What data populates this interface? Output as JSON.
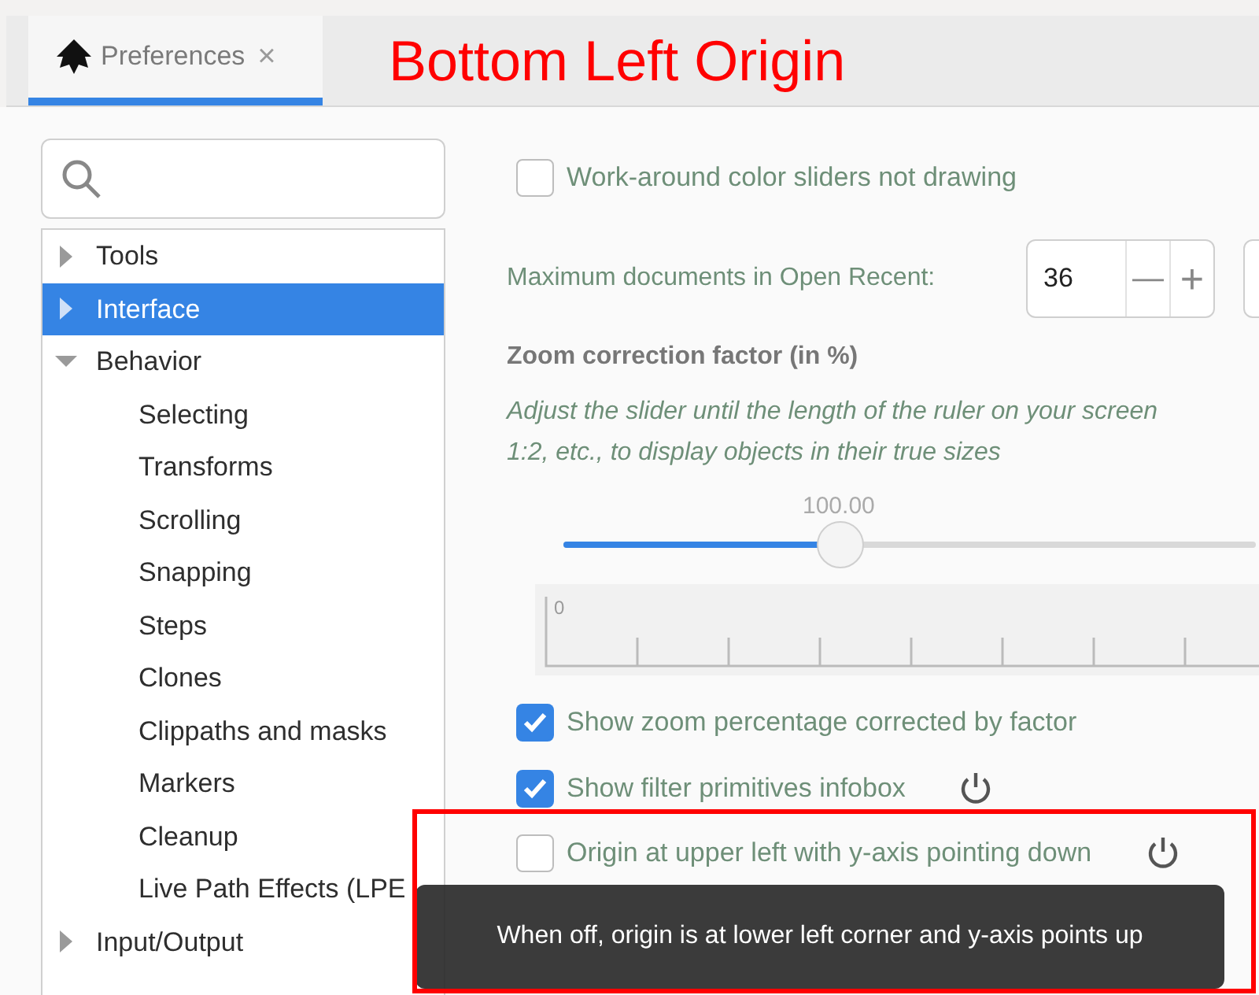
{
  "tab": {
    "label": "Preferences",
    "close": "×",
    "selected": true
  },
  "annotation": {
    "title": "Bottom Left Origin"
  },
  "tree": [
    {
      "label": "Tools",
      "expanded": false,
      "selected": false
    },
    {
      "label": "Interface",
      "expanded": false,
      "selected": true
    },
    {
      "label": "Behavior",
      "expanded": true,
      "selected": false,
      "children": [
        {
          "label": "Selecting",
          "selected": false
        },
        {
          "label": "Transforms",
          "selected": false
        },
        {
          "label": "Scrolling",
          "selected": false
        },
        {
          "label": "Snapping",
          "selected": false
        },
        {
          "label": "Steps",
          "selected": false
        },
        {
          "label": "Clones",
          "selected": false
        },
        {
          "label": "Clippaths and masks",
          "selected": false
        },
        {
          "label": "Markers",
          "selected": false
        },
        {
          "label": "Cleanup",
          "selected": false
        },
        {
          "label": "Live Path Effects (LPE",
          "selected": false
        }
      ]
    },
    {
      "label": "Input/Output",
      "expanded": false,
      "selected": false
    }
  ],
  "workaround": {
    "label": "Work-around color sliders not drawing",
    "checked": false
  },
  "recent": {
    "label": "Maximum documents in Open Recent:",
    "value": "36",
    "minus": "—",
    "plus": "+"
  },
  "zoom": {
    "heading": "Zoom correction factor (in %)",
    "description": [
      "Adjust the slider until the length of the ruler on your screen",
      "1:2, etc., to display objects in their true sizes"
    ],
    "value": "100.00",
    "level": 0.4,
    "ruler_label": "0"
  },
  "options": [
    {
      "label": "Show zoom percentage corrected by factor",
      "checked": true,
      "reset": false
    },
    {
      "label": "Show filter primitives infobox",
      "checked": true,
      "reset": true
    },
    {
      "label": "Origin at upper left with y-axis pointing down",
      "checked": false,
      "reset": true
    }
  ],
  "tooltip": "When off, origin is at lower left corner and y-axis points up"
}
